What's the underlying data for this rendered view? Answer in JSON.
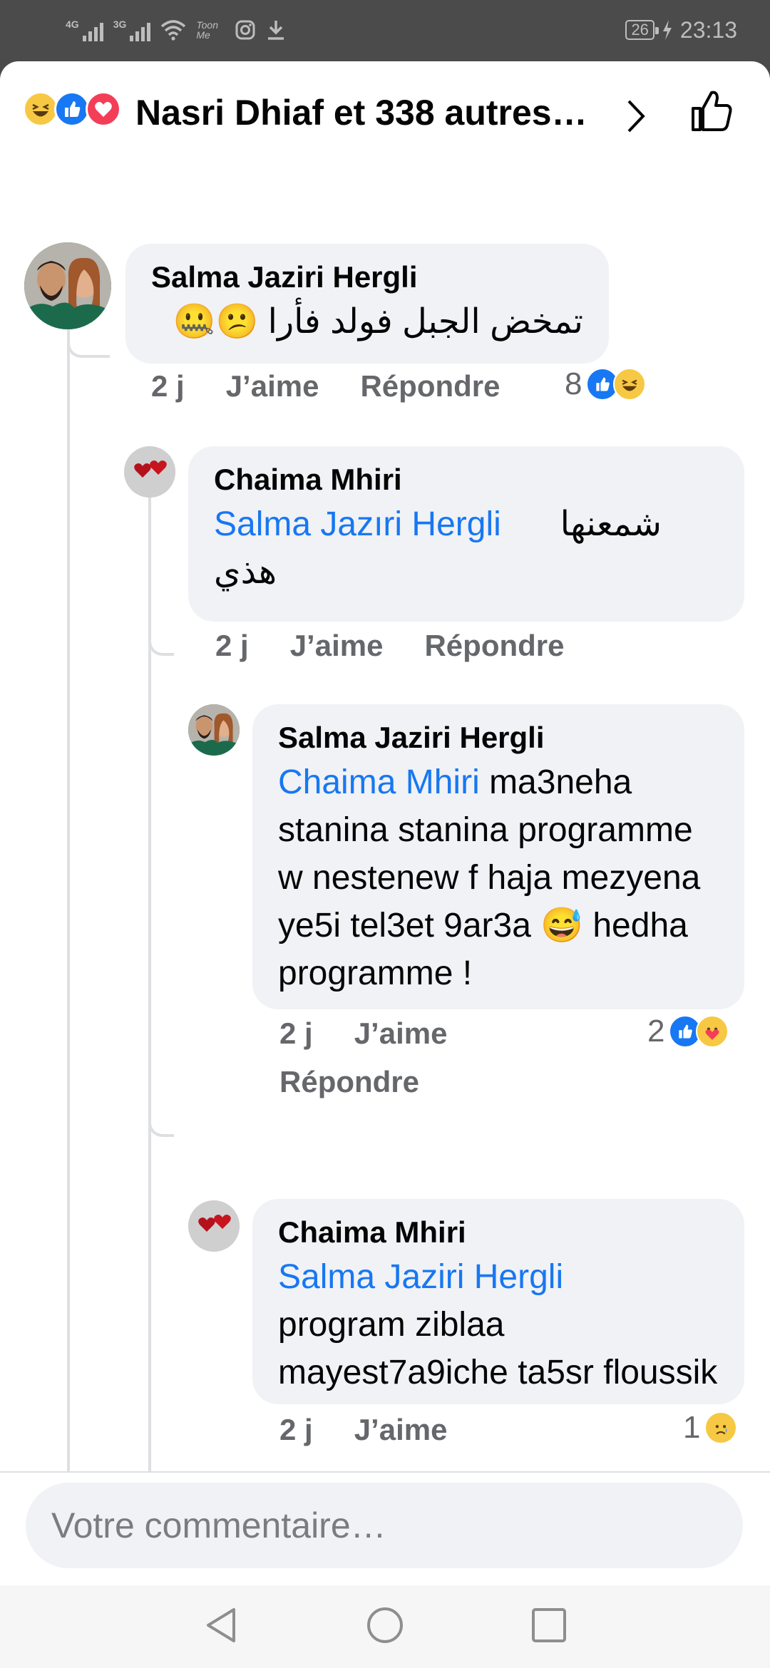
{
  "status_bar": {
    "network_1": "4G",
    "network_2": "3G",
    "toon_label": "Toon Me",
    "battery": "26",
    "time": "23:13"
  },
  "header": {
    "title": "Nasri Dhiaf et 338 autres…",
    "reactions": [
      "haha",
      "like",
      "love"
    ]
  },
  "comments": [
    {
      "author": "Salma Jaziri Hergli",
      "text": "تمخض الجبل فولد فأرا",
      "emoji": [
        "😕",
        "🤐"
      ],
      "time": "2 j",
      "like_label": "J’aime",
      "reply_label": "Répondre",
      "reaction_count": "8",
      "reactions": [
        "like",
        "haha"
      ]
    },
    {
      "author": "Chaima Mhiri",
      "mention": "Salma Jazıri Hergli",
      "text_line1": "شمعنها",
      "text_line2": "هذي",
      "time": "2 j",
      "like_label": "J’aime",
      "reply_label": "Répondre"
    },
    {
      "author": "Salma Jaziri Hergli",
      "mention": "Chaima Mhiri",
      "text_a": " ma3neha stanina stanina programme w nestenew f haja mezyena ye5i tel3et 9ar3a ",
      "emoji": "😅",
      "text_b": " hedha programme !",
      "time": "2 j",
      "like_label": "J’aime",
      "reply_label": "Répondre",
      "reaction_count": "2",
      "reactions": [
        "like",
        "care"
      ]
    },
    {
      "author": "Chaima Mhiri",
      "mention": "Salma Jaziri Hergli",
      "text": "program ziblaa mayest7a9iche  ta5sr floussik",
      "time": "2 j",
      "like_label": "J’aime",
      "reaction_count": "1",
      "reactions": [
        "sad"
      ]
    }
  ],
  "composer": {
    "placeholder": "Votre commentaire…"
  },
  "colors": {
    "accent": "#1877f2",
    "bubble": "#f0f2f5",
    "meta_text": "#65676b"
  }
}
